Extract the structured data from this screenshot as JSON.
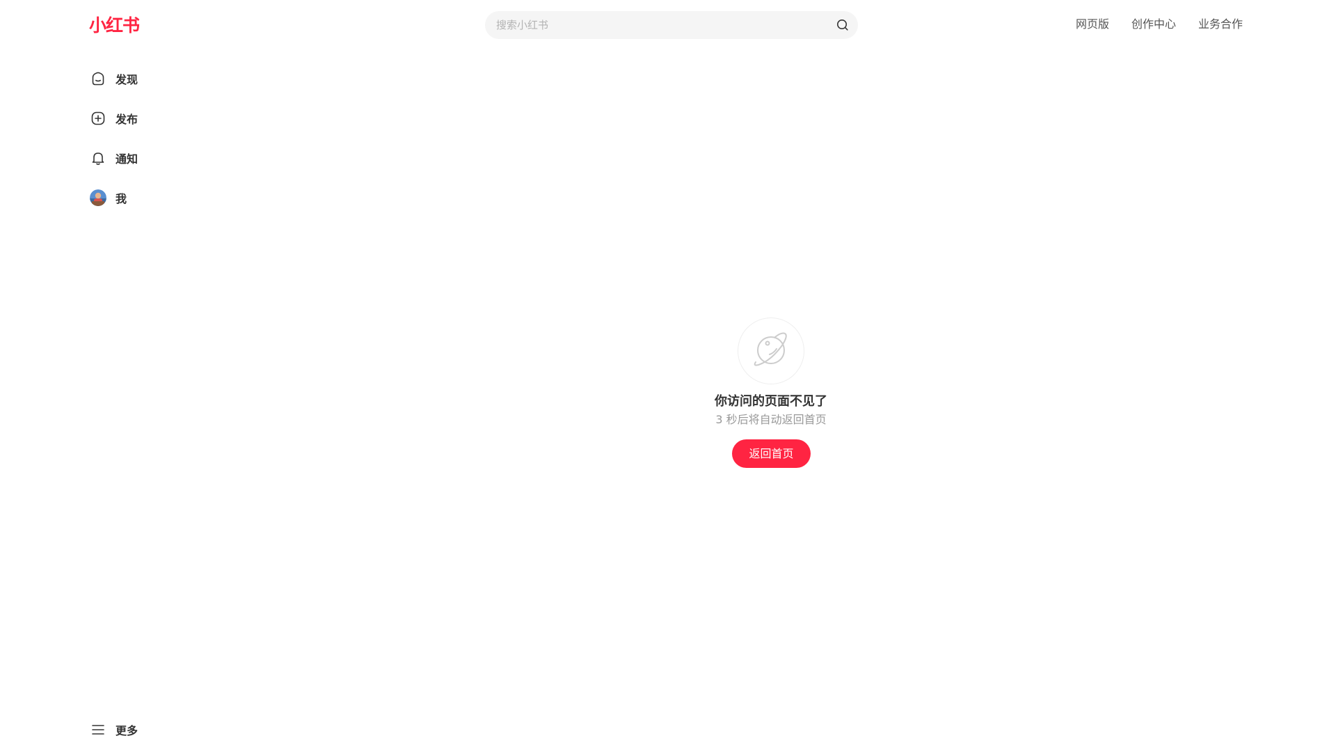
{
  "header": {
    "logo_text": "小红书",
    "search": {
      "placeholder": "搜索小红书",
      "value": ""
    },
    "links": [
      "网页版",
      "创作中心",
      "业务合作"
    ]
  },
  "sidebar": {
    "items": [
      {
        "label": "发现",
        "icon": "home-icon"
      },
      {
        "label": "发布",
        "icon": "plus-square-icon"
      },
      {
        "label": "通知",
        "icon": "bell-icon"
      },
      {
        "label": "我",
        "icon": "avatar"
      }
    ],
    "more_label": "更多"
  },
  "main": {
    "icon": "planet-icon",
    "title": "你访问的页面不见了",
    "subtitle": "3 秒后将自动返回首页",
    "button_label": "返回首页"
  },
  "colors": {
    "brand": "#ff2442",
    "text": "#333333",
    "muted": "#999999",
    "search_bg": "#f5f5f5"
  }
}
